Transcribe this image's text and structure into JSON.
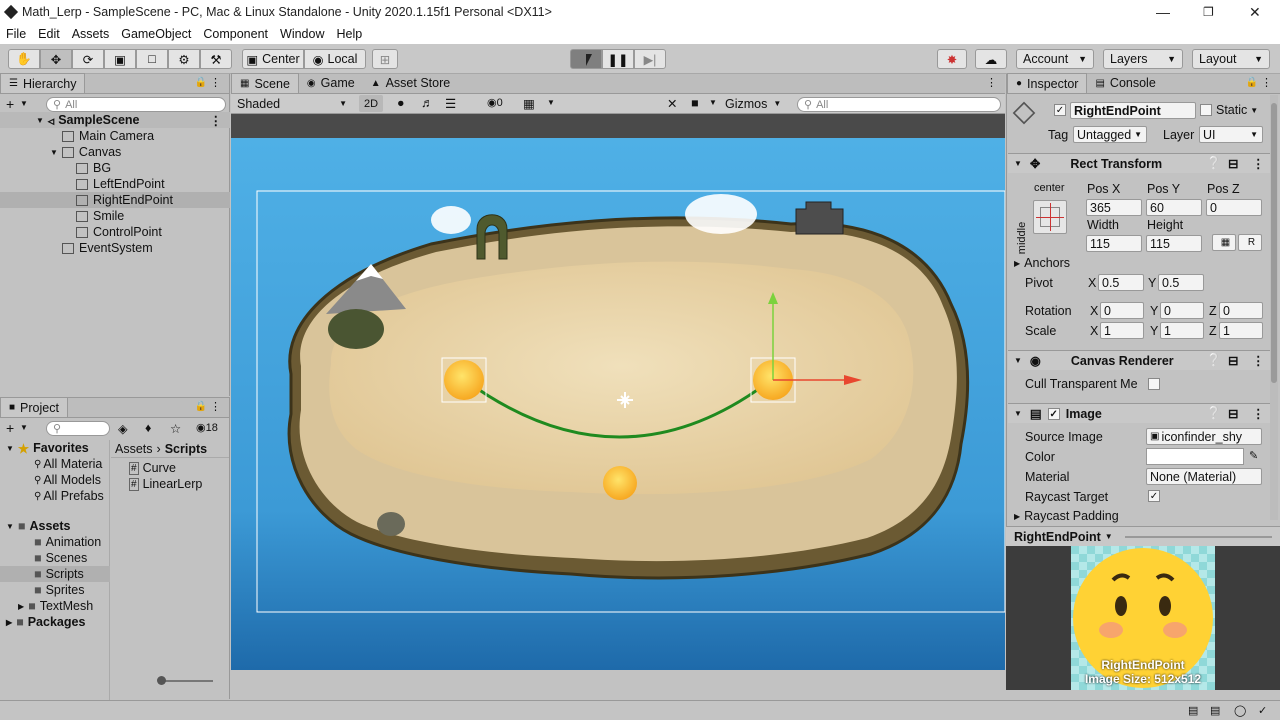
{
  "window": {
    "title": "Math_Lerp - SampleScene - PC, Mac & Linux Standalone - Unity 2020.1.15f1 Personal <DX11>"
  },
  "menu": [
    "File",
    "Edit",
    "Assets",
    "GameObject",
    "Component",
    "Window",
    "Help"
  ],
  "toolbar": {
    "center": "Center",
    "local": "Local",
    "account": "Account",
    "layers": "Layers",
    "layout": "Layout"
  },
  "hierarchy": {
    "tab": "Hierarchy",
    "search_placeholder": "All",
    "items": [
      {
        "label": "SampleScene"
      },
      {
        "label": "Main Camera"
      },
      {
        "label": "Canvas"
      },
      {
        "label": "BG"
      },
      {
        "label": "LeftEndPoint"
      },
      {
        "label": "RightEndPoint"
      },
      {
        "label": "Smile"
      },
      {
        "label": "ControlPoint"
      },
      {
        "label": "EventSystem"
      }
    ]
  },
  "scene": {
    "tabs": [
      "Scene",
      "Game",
      "Asset Store"
    ],
    "shading": "Shaded",
    "mode2d": "2D",
    "hidden_count": "0",
    "gizmos": "Gizmos",
    "search_placeholder": "All"
  },
  "project": {
    "tab": "Project",
    "hidden_count": "18",
    "favorites_label": "Favorites",
    "favorites": [
      "All Materia",
      "All Models",
      "All Prefabs"
    ],
    "assets_label": "Assets",
    "folders": [
      "Animation",
      "Scenes",
      "Scripts",
      "Sprites",
      "TextMesh"
    ],
    "packages": "Packages",
    "breadcrumb": [
      "Assets",
      "Scripts"
    ],
    "files": [
      "Curve",
      "LinearLerp"
    ]
  },
  "inspector": {
    "tabs": [
      "Inspector",
      "Console"
    ],
    "object_name": "RightEndPoint",
    "static": "Static",
    "tag_label": "Tag",
    "tag": "Untagged",
    "layer_label": "Layer",
    "layer": "UI",
    "rect_transform": {
      "title": "Rect Transform",
      "anchor_h": "center",
      "anchor_v": "middle",
      "headers": [
        "Pos X",
        "Pos Y",
        "Pos Z"
      ],
      "pos": [
        "365",
        "60",
        "0"
      ],
      "size_headers": [
        "Width",
        "Height"
      ],
      "size": [
        "115",
        "115"
      ],
      "anchors": "Anchors",
      "pivot_label": "Pivot",
      "pivot": [
        "0.5",
        "0.5"
      ],
      "rotation_label": "Rotation",
      "rotation": [
        "0",
        "0",
        "0"
      ],
      "scale_label": "Scale",
      "scale": [
        "1",
        "1",
        "1"
      ],
      "r_button": "R"
    },
    "canvas_renderer": {
      "title": "Canvas Renderer",
      "cull": "Cull Transparent Me"
    },
    "image": {
      "title": "Image",
      "source_label": "Source Image",
      "source": "iconfinder_shy",
      "color_label": "Color",
      "material_label": "Material",
      "material": "None (Material)",
      "raycast_label": "Raycast Target",
      "padding_label": "Raycast Padding"
    },
    "preview": {
      "title": "RightEndPoint",
      "name": "RightEndPoint",
      "size": "Image Size: 512x512"
    }
  },
  "colors": {
    "accent": "#3a72d0",
    "sea": "#3fa0dc",
    "sand": "#e8d3aa",
    "curve": "#1f8a1f"
  }
}
